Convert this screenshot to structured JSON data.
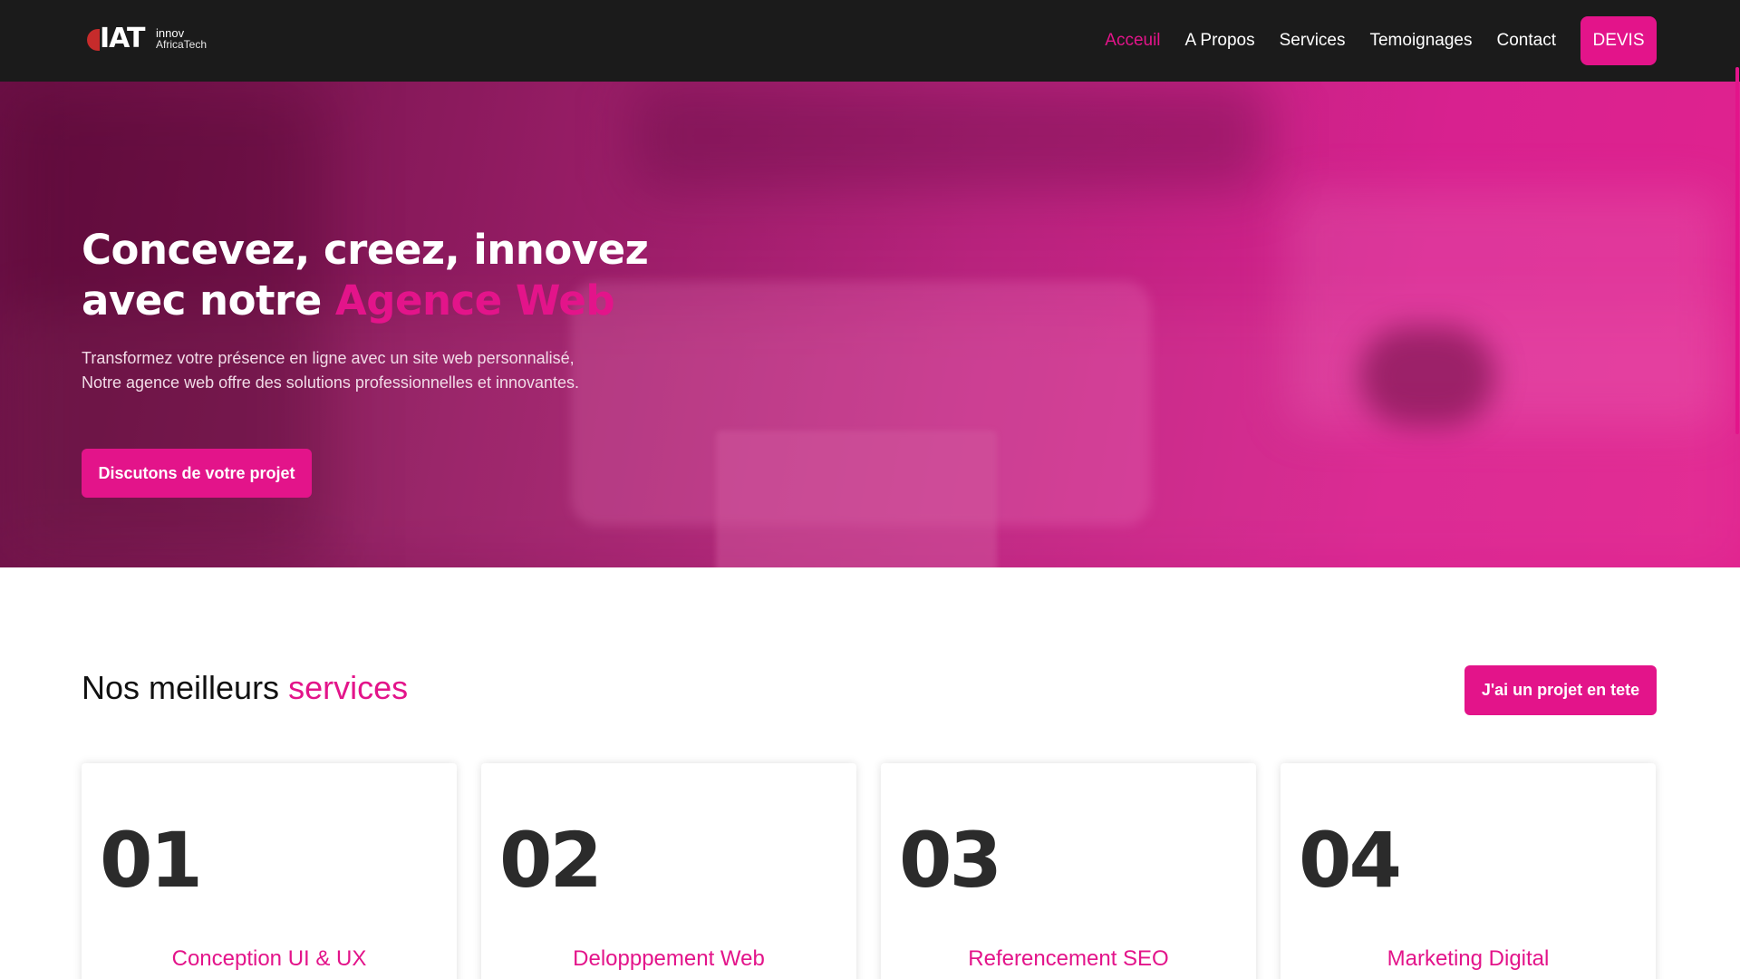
{
  "header": {
    "logo": {
      "mark": "IAT",
      "line1": "innov",
      "line2": "AfricaTech"
    },
    "nav": [
      {
        "label": "Acceuil",
        "active": true
      },
      {
        "label": "A Propos",
        "active": false
      },
      {
        "label": "Services",
        "active": false
      },
      {
        "label": "Temoignages",
        "active": false
      },
      {
        "label": "Contact",
        "active": false
      }
    ],
    "cta": "DEVIS"
  },
  "hero": {
    "title_line1": "Concevez, creez, innovez",
    "title_line2_prefix": "avec notre ",
    "title_line2_accent": "Agence Web",
    "subtitle_line1": "Transformez votre présence en ligne avec un site web personnalisé,",
    "subtitle_line2": "Notre agence web offre des solutions professionnelles et innovantes.",
    "button": "Discutons de votre projet"
  },
  "services": {
    "title_prefix": "Nos meilleurs ",
    "title_accent": "services",
    "button": "J'ai un projet en tete",
    "cards": [
      {
        "number": "01",
        "name": "Conception UI & UX"
      },
      {
        "number": "02",
        "name": "Delopppement Web"
      },
      {
        "number": "03",
        "name": "Referencement SEO"
      },
      {
        "number": "04",
        "name": "Marketing Digital"
      }
    ]
  },
  "colors": {
    "accent": "#e3148a",
    "header_bg": "#1b1b1b",
    "text_dark": "#2b2b2b"
  }
}
